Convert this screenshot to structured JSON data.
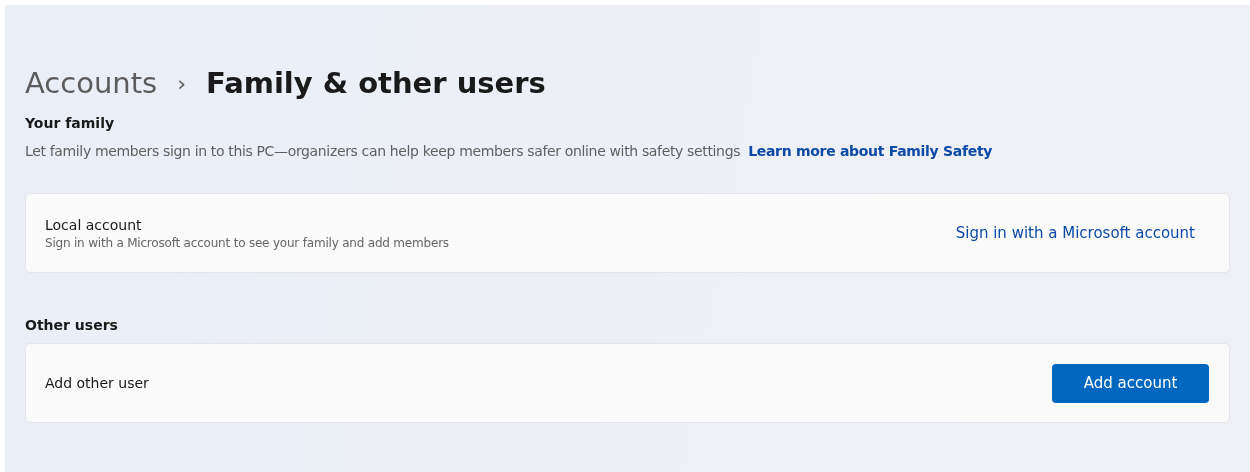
{
  "breadcrumb": {
    "parent": "Accounts",
    "separator": "›",
    "current": "Family & other users"
  },
  "your_family": {
    "heading": "Your family",
    "description": "Let family members sign in to this PC—organizers can help keep members safer online with safety settings",
    "link": "Learn more about Family Safety",
    "card": {
      "title": "Local account",
      "subtitle": "Sign in with a Microsoft account to see your family and add members",
      "action": {
        "kind": "link",
        "label": "Sign in with a Microsoft account"
      }
    }
  },
  "other_users": {
    "heading": "Other users",
    "card": {
      "title": "Add other user",
      "action": {
        "kind": "button",
        "label": "Add account"
      }
    }
  }
}
